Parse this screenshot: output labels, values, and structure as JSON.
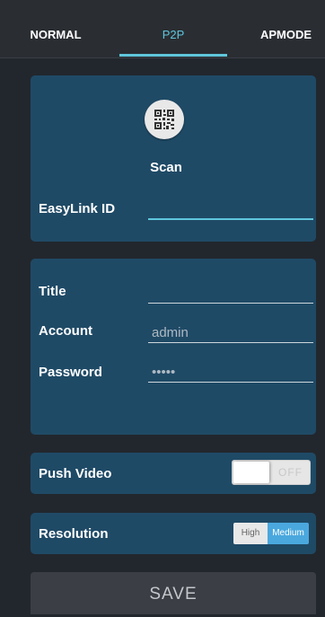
{
  "tabs": [
    {
      "label": "NORMAL",
      "active": false
    },
    {
      "label": "P2P",
      "active": true
    },
    {
      "label": "APMODE",
      "active": false
    }
  ],
  "scan": {
    "label": "Scan",
    "icon": "qr-code-icon"
  },
  "easylink": {
    "label": "EasyLink ID",
    "value": ""
  },
  "credentials": {
    "title_label": "Title",
    "title_value": "",
    "account_label": "Account",
    "account_value": "admin",
    "password_label": "Password",
    "password_value": "•••••"
  },
  "push_video": {
    "label": "Push Video",
    "state_label": "OFF",
    "on": false
  },
  "resolution": {
    "label": "Resolution",
    "options": [
      "High",
      "Medium"
    ],
    "selected": "Medium"
  },
  "save": {
    "label": "SAVE"
  },
  "colors": {
    "accent": "#5fc6dc",
    "panel": "#1f4a66",
    "background": "#22272d",
    "segment_selected": "#4aa8de"
  }
}
